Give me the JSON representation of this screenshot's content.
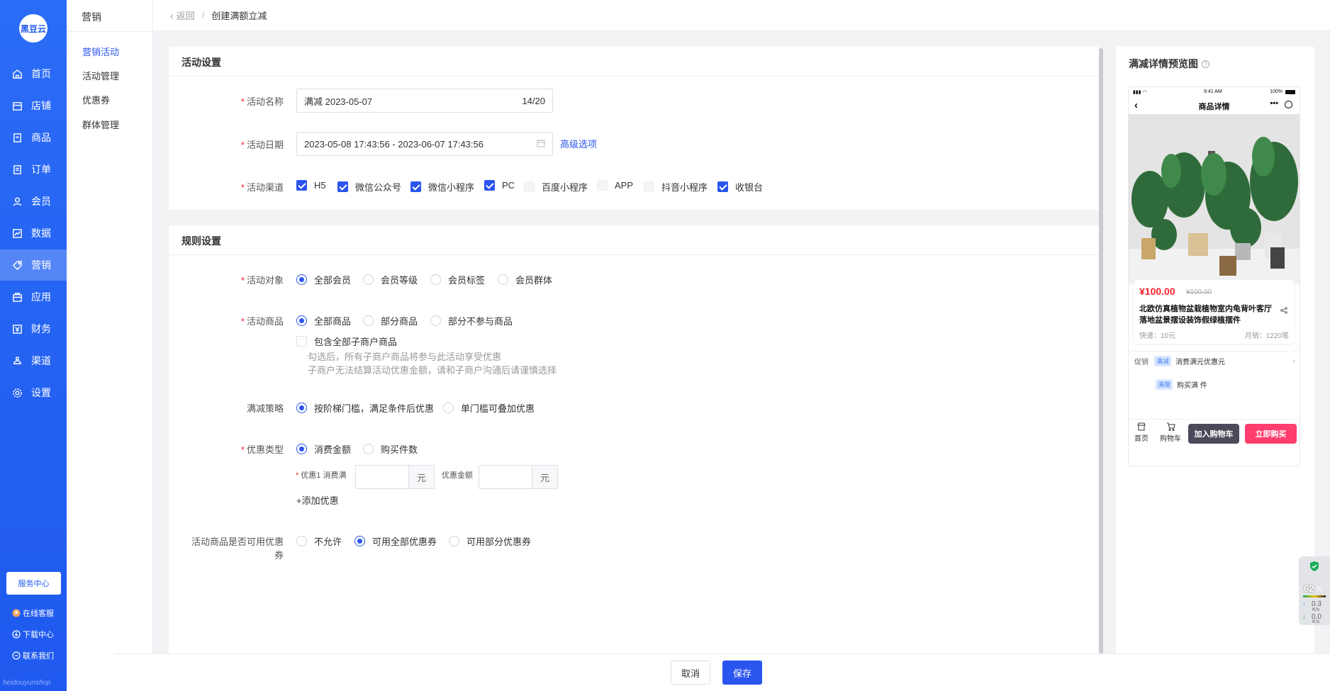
{
  "brand": {
    "logo_text": "黑豆云"
  },
  "nav": [
    {
      "label": "首页",
      "icon": "home-icon"
    },
    {
      "label": "店铺",
      "icon": "store-icon"
    },
    {
      "label": "商品",
      "icon": "goods-icon"
    },
    {
      "label": "订单",
      "icon": "order-icon"
    },
    {
      "label": "会员",
      "icon": "member-icon"
    },
    {
      "label": "数据",
      "icon": "data-icon"
    },
    {
      "label": "营销",
      "icon": "tag-icon"
    },
    {
      "label": "应用",
      "icon": "app-icon"
    },
    {
      "label": "财务",
      "icon": "finance-icon"
    },
    {
      "label": "渠道",
      "icon": "channel-icon"
    },
    {
      "label": "设置",
      "icon": "gear-icon"
    }
  ],
  "service_center": "服务中心",
  "side_links": [
    {
      "label": "在线客服",
      "icon": "avatar-icon"
    },
    {
      "label": "下载中心",
      "icon": "download-icon"
    },
    {
      "label": "联系我们",
      "icon": "contact-icon"
    }
  ],
  "footer_mark": "heidouyunshop",
  "submenu": {
    "title": "营销",
    "items": [
      "营销活动",
      "活动管理",
      "优惠券",
      "群体管理"
    ]
  },
  "breadcrumb": {
    "back": "返回",
    "separator": "/",
    "current": "创建满额立减"
  },
  "activity": {
    "section_title": "活动设置",
    "name_label": "活动名称",
    "name_value": "满减  2023-05-07",
    "name_count": "14/20",
    "date_label": "活动日期",
    "date_value": "2023-05-08 17:43:56 - 2023-06-07 17:43:56",
    "advanced_link": "高级选项",
    "channel_label": "活动渠道",
    "channels": [
      {
        "label": "H5",
        "checked": true
      },
      {
        "label": "微信公众号",
        "checked": true
      },
      {
        "label": "微信小程序",
        "checked": true
      },
      {
        "label": "PC",
        "checked": true
      },
      {
        "label": "百度小程序",
        "checked": false
      },
      {
        "label": "APP",
        "checked": false
      },
      {
        "label": "抖音小程序",
        "checked": false
      },
      {
        "label": "收银台",
        "checked": true
      }
    ]
  },
  "rules": {
    "section_title": "规则设置",
    "target_label": "活动对象",
    "targets": [
      "全部会员",
      "会员等级",
      "会员标签",
      "会员群体"
    ],
    "goods_label": "活动商品",
    "goods": [
      "全部商品",
      "部分商品",
      "部分不参与商品"
    ],
    "include_sub_label": "包含全部子商户商品",
    "hint_line1": "勾选后，所有子商户商品将参与此活动享受优惠",
    "hint_line2": "子商户无法结算活动优惠金额，请和子商户沟通后请谨慎选择",
    "strategy_label": "满减策略",
    "strategies": [
      "按阶梯门槛，满足条件后优惠",
      "单门槛可叠加优惠"
    ],
    "discount_type_label": "优惠类型",
    "discount_types": [
      "消费金额",
      "购买件数"
    ],
    "tier_label": "优惠1 消费满",
    "tier_unit": "元",
    "amount_label": "优惠金额",
    "amount_unit": "元",
    "add_tier": "+添加优惠",
    "coupon_label": "活动商品是否可用优惠券",
    "coupon_options": [
      "不允许",
      "可用全部优惠券",
      "可用部分优惠券"
    ]
  },
  "preview": {
    "title": "满减详情预览图",
    "status_time": "9:41 AM",
    "status_battery": "100%",
    "nav_title": "商品详情",
    "price": "¥100.00",
    "old_price": "¥100.00",
    "product_title": "北欧仿真植物盆栽植物室内龟背叶客厅落地盆景摆设装饰假绿植摆件",
    "shipping": "快递：10元",
    "monthly_sales": "月销：1220笔",
    "promo_label": "促销",
    "promo_tag1": "满减",
    "promo_text1": "消费满元优惠元",
    "promo_tag2": "满赠",
    "promo_text2": "购买满 件",
    "bottom_home": "首页",
    "bottom_cart": "购物车",
    "add_cart": "加入购物车",
    "buy_now": "立即购买"
  },
  "actions": {
    "cancel": "取消",
    "save": "保存"
  },
  "monitor": {
    "percent": "62",
    "unit": "%",
    "up": "0.3",
    "up_unit": "K/s",
    "down": "0.0",
    "down_unit": "K/s"
  },
  "colors": {
    "primary": "#2b55ef",
    "sidebar": "#1f59ef",
    "danger": "#f5222d",
    "buy": "#ff3d6e",
    "cart": "#4a4a5a"
  }
}
